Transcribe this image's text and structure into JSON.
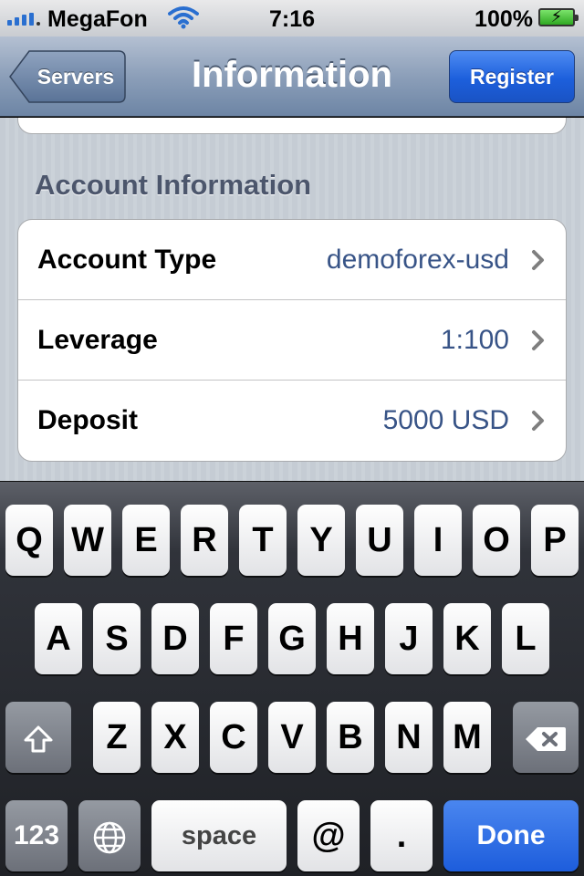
{
  "status_bar": {
    "carrier": "MegaFon",
    "time": "7:16",
    "battery_percent": "100%",
    "battery_level": 1.0,
    "wifi_icon": "wifi-icon",
    "signal_icon": "signal-bars-icon",
    "battery_icon": "battery-charging-icon"
  },
  "nav": {
    "title": "Information",
    "back_label": "Servers",
    "right_label": "Register",
    "accent_color": "#1c5fdc"
  },
  "section": {
    "header": "Account Information",
    "rows": [
      {
        "label": "Account Type",
        "value": "demoforex-usd"
      },
      {
        "label": "Leverage",
        "value": "1:100"
      },
      {
        "label": "Deposit",
        "value": "5000 USD"
      }
    ]
  },
  "keyboard": {
    "row1": [
      "Q",
      "W",
      "E",
      "R",
      "T",
      "Y",
      "U",
      "I",
      "O",
      "P"
    ],
    "row2": [
      "A",
      "S",
      "D",
      "F",
      "G",
      "H",
      "J",
      "K",
      "L"
    ],
    "row3": [
      "Z",
      "X",
      "C",
      "V",
      "B",
      "N",
      "M"
    ],
    "numbers_key": "123",
    "space_key": "space",
    "at_key": "@",
    "dot_key": ".",
    "done_key": "Done",
    "globe_icon": "globe-icon",
    "shift_icon": "shift-icon",
    "delete_icon": "backspace-icon"
  }
}
